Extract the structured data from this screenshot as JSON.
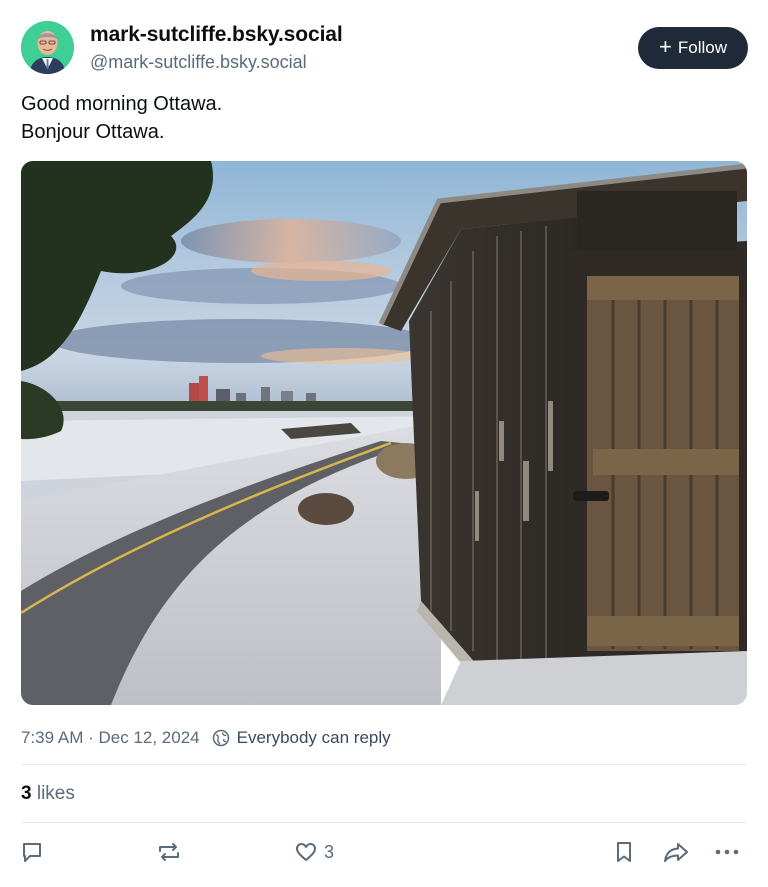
{
  "author": {
    "display_name": "mark-sutcliffe.bsky.social",
    "handle": "@mark-sutcliffe.bsky.social",
    "avatar_icon": "person-avatar",
    "avatar_bg": "#3fcf95"
  },
  "follow": {
    "label": "Follow",
    "icon": "plus-icon",
    "bg": "#1e2a38"
  },
  "post": {
    "lines": [
      "Good morning Ottawa.",
      "Bonjour Ottawa."
    ],
    "image_icon": "photo-ottawa-shed"
  },
  "meta": {
    "timestamp": "7:39 AM · Dec 12, 2024",
    "reply_setting": "Everybody can reply",
    "reply_icon": "globe-icon"
  },
  "likes": {
    "count": "3",
    "label": "likes"
  },
  "actions": {
    "reply_icon": "comment-icon",
    "repost_icon": "repost-icon",
    "like_icon": "heart-icon",
    "like_count": "3",
    "bookmark_icon": "bookmark-icon",
    "share_icon": "share-icon",
    "more_icon": "more-icon"
  },
  "colors": {
    "text": "#0b0f14",
    "muted": "#5b6b7c",
    "divider": "#e4e8ec"
  }
}
